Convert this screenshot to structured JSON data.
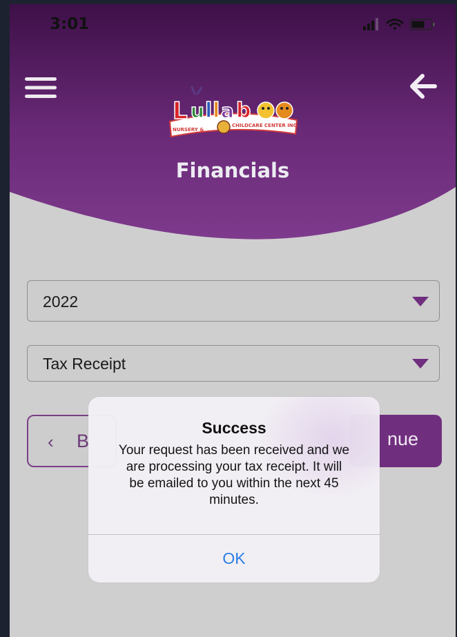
{
  "status_bar": {
    "time": "3:01",
    "icons": [
      "signal-icon",
      "wifi-icon",
      "battery-icon"
    ]
  },
  "header": {
    "title": "Financials",
    "logo_text": "Lullaboo",
    "logo_subtext": "NURSERY & CHILDCARE CENTER INC.",
    "menu_icon": "menu-icon",
    "back_icon": "arrow-left-icon"
  },
  "form": {
    "year_select": {
      "value": "2022"
    },
    "document_select": {
      "value": "Tax Receipt"
    },
    "back_button": {
      "label": "B",
      "icon": "chevron-left-icon"
    },
    "continue_button": {
      "label": "nue"
    }
  },
  "alert": {
    "title": "Success",
    "message_lines": [
      "Your request has been received and we",
      "are processing your tax receipt. It will",
      "be emailed to you within the next 45",
      "minutes."
    ],
    "ok_label": "OK"
  },
  "colors": {
    "header_purple": "#7a3585",
    "header_purple_dark": "#3e1048",
    "background": "#cfcfcf",
    "accent_purple": "#6f2f7e",
    "ios_blue": "#2a7ee6"
  }
}
